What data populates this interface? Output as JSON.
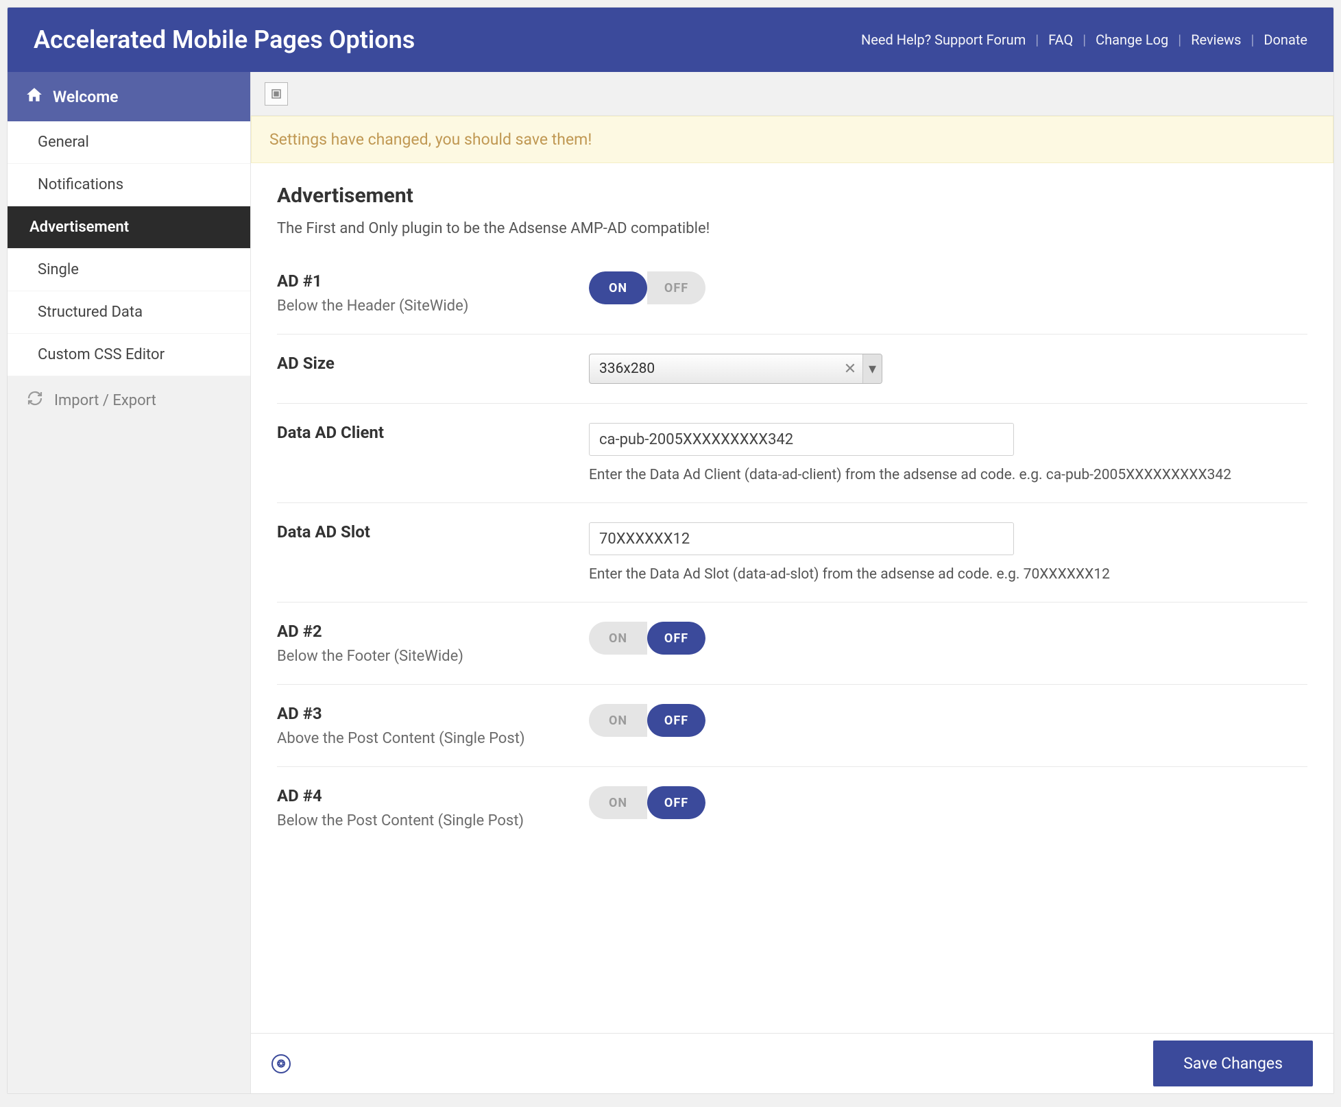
{
  "header": {
    "title": "Accelerated Mobile Pages Options",
    "links": {
      "help": "Need Help? Support Forum",
      "faq": "FAQ",
      "changelog": "Change Log",
      "reviews": "Reviews",
      "donate": "Donate"
    }
  },
  "sidebar": {
    "welcome": "Welcome",
    "items": [
      "General",
      "Notifications",
      "Advertisement",
      "Single",
      "Structured Data",
      "Custom CSS Editor"
    ],
    "active_index": 2,
    "import_export": "Import / Export"
  },
  "notice": "Settings have changed, you should save them!",
  "page": {
    "heading": "Advertisement",
    "subtitle": "The First and Only plugin to be the Adsense AMP-AD compatible!"
  },
  "toggle_labels": {
    "on": "ON",
    "off": "OFF"
  },
  "rows": {
    "ad1": {
      "title": "AD #1",
      "desc": "Below the Header (SiteWide)",
      "state": "on"
    },
    "size": {
      "title": "AD Size",
      "value": "336x280"
    },
    "client": {
      "title": "Data AD Client",
      "value": "ca-pub-2005XXXXXXXXX342",
      "help": "Enter the Data Ad Client (data-ad-client) from the adsense ad code. e.g. ca-pub-2005XXXXXXXXX342"
    },
    "slot": {
      "title": "Data AD Slot",
      "value": "70XXXXXX12",
      "help": "Enter the Data Ad Slot (data-ad-slot) from the adsense ad code. e.g. 70XXXXXX12"
    },
    "ad2": {
      "title": "AD #2",
      "desc": "Below the Footer (SiteWide)",
      "state": "off"
    },
    "ad3": {
      "title": "AD #3",
      "desc": "Above the Post Content (Single Post)",
      "state": "off"
    },
    "ad4": {
      "title": "AD #4",
      "desc": "Below the Post Content (Single Post)",
      "state": "off"
    }
  },
  "footer": {
    "save": "Save Changes"
  }
}
